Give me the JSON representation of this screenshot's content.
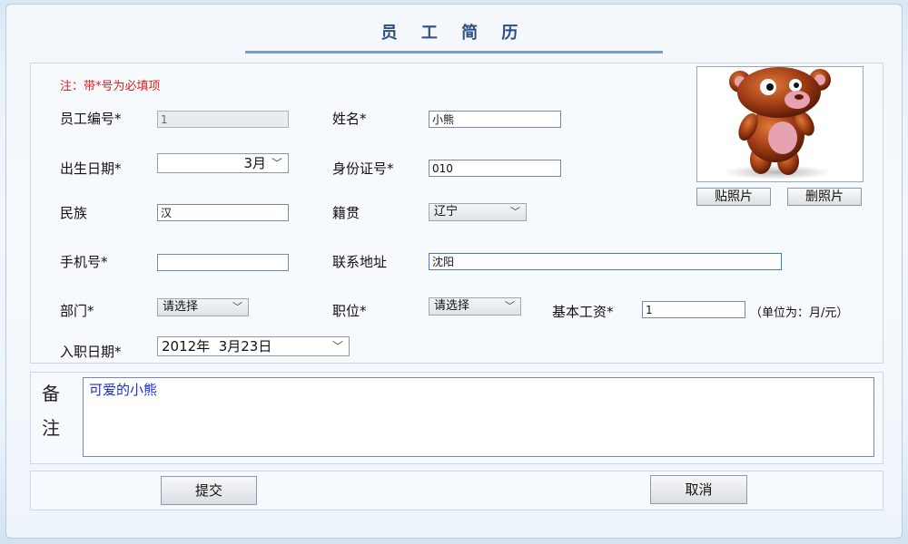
{
  "title": "员 工 简 历",
  "note": "注：带*号为必填项",
  "fields": {
    "emp_id": {
      "label": "员工编号*",
      "value": "1"
    },
    "name": {
      "label": "姓名*",
      "value": "小熊"
    },
    "birth": {
      "label": "出生日期*",
      "value": "3月"
    },
    "id_card": {
      "label": "身份证号*",
      "value": "010"
    },
    "ethnicity": {
      "label": "民族",
      "value": "汉"
    },
    "native": {
      "label": "籍贯",
      "value": "辽宁"
    },
    "phone": {
      "label": "手机号*",
      "value": ""
    },
    "address": {
      "label": "联系地址",
      "value": "沈阳"
    },
    "dept": {
      "label": "部门*",
      "value": "请选择"
    },
    "position": {
      "label": "职位*",
      "value": "请选择"
    },
    "salary": {
      "label": "基本工资*",
      "value": "1",
      "unit": "（单位为：月/元）"
    },
    "hire_date": {
      "label": "入职日期*",
      "value": "2012年  3月23日"
    }
  },
  "photo": {
    "icon": "teddy-bear-photo",
    "paste_label": "贴照片",
    "delete_label": "删照片"
  },
  "remark": {
    "label_1": "备",
    "label_2": "注",
    "value": "可爱的小熊"
  },
  "buttons": {
    "submit": "提交",
    "cancel": "取消"
  },
  "colors": {
    "note": "#e0201c",
    "remark_text": "#1a2fd8",
    "title": "#2d4e7e"
  }
}
